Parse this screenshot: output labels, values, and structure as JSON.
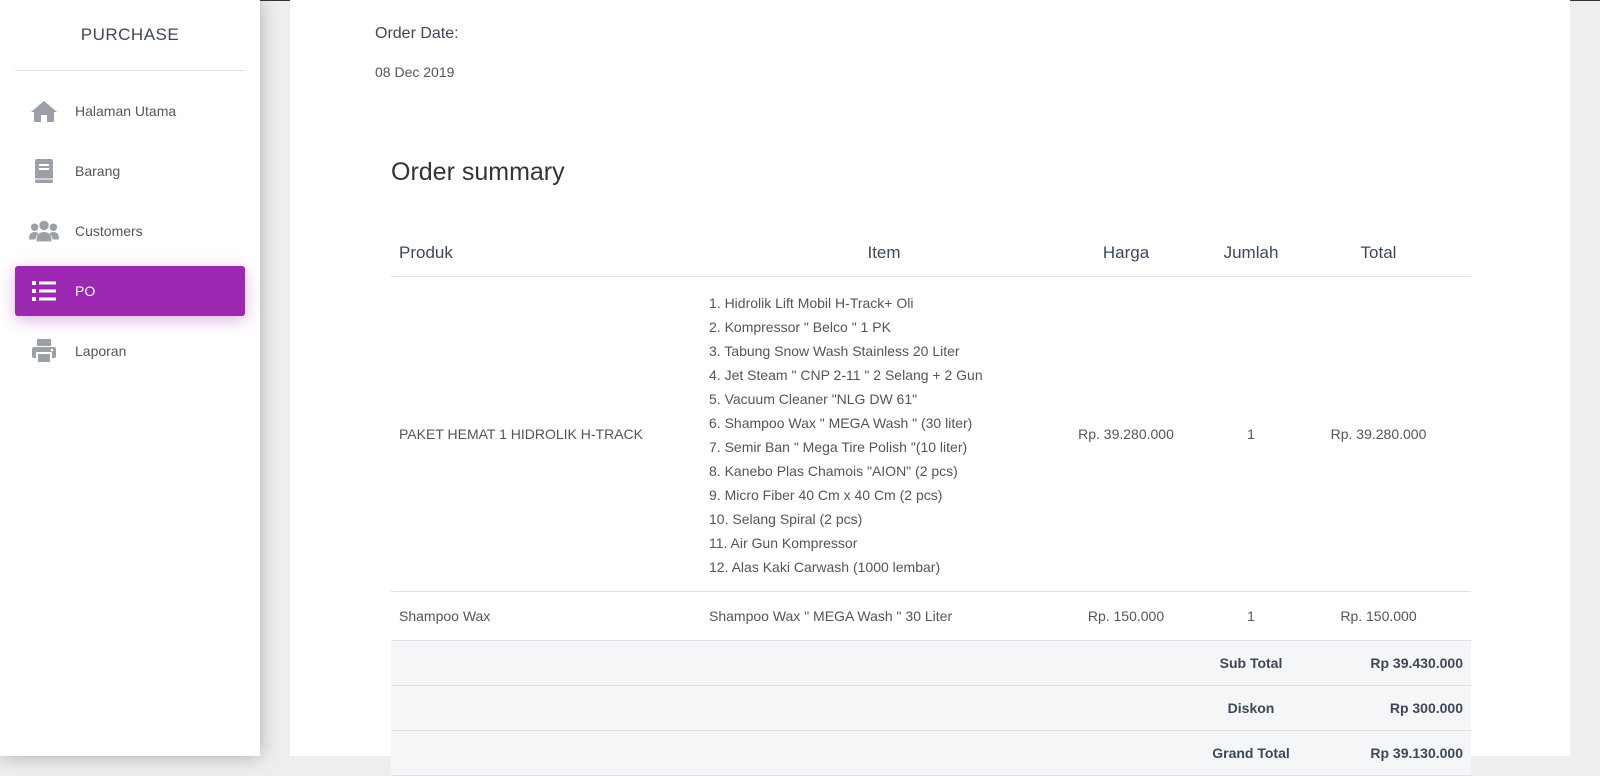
{
  "sidebar": {
    "brand": "PURCHASE",
    "active_color": "#9c27b0",
    "items": [
      {
        "label": "Halaman Utama",
        "icon": "home-icon"
      },
      {
        "label": "Barang",
        "icon": "book-icon"
      },
      {
        "label": "Customers",
        "icon": "users-icon"
      },
      {
        "label": "PO",
        "icon": "list-icon",
        "active": true
      },
      {
        "label": "Laporan",
        "icon": "print-icon"
      }
    ]
  },
  "order": {
    "date_label": "Order Date:",
    "date_value": "08 Dec 2019"
  },
  "summary": {
    "title": "Order summary",
    "columns": [
      "Produk",
      "Item",
      "Harga",
      "Jumlah",
      "Total"
    ],
    "rows": [
      {
        "produk": "PAKET HEMAT 1 HIDROLIK H-TRACK",
        "items": [
          "1. Hidrolik Lift Mobil H-Track+ Oli",
          "2. Kompressor \" Belco \" 1 PK",
          "3. Tabung Snow Wash Stainless 20 Liter",
          "4. Jet Steam \" CNP 2-11 \" 2 Selang + 2 Gun",
          "5. Vacuum Cleaner \"NLG DW 61\"",
          "6. Shampoo Wax \" MEGA Wash \" (30 liter)",
          "7. Semir Ban \" Mega Tire Polish \"(10 liter)",
          "8. Kanebo Plas Chamois \"AION\" (2 pcs)",
          "9. Micro Fiber 40 Cm x 40 Cm (2 pcs)",
          "10. Selang Spiral (2 pcs)",
          "11. Air Gun Kompressor",
          "12. Alas Kaki Carwash (1000 lembar)"
        ],
        "harga": "Rp. 39.280.000",
        "jumlah": "1",
        "total": "Rp. 39.280.000"
      },
      {
        "produk": "Shampoo Wax",
        "item": "Shampoo Wax \" MEGA Wash \" 30 Liter",
        "harga": "Rp. 150.000",
        "jumlah": "1",
        "total": "Rp. 150.000"
      }
    ],
    "subtotal_label": "Sub Total",
    "subtotal_value": "Rp 39.430.000",
    "diskon_label": "Diskon",
    "diskon_value": "Rp 300.000",
    "grandtotal_label": "Grand Total",
    "grandtotal_value": "Rp 39.130.000"
  }
}
